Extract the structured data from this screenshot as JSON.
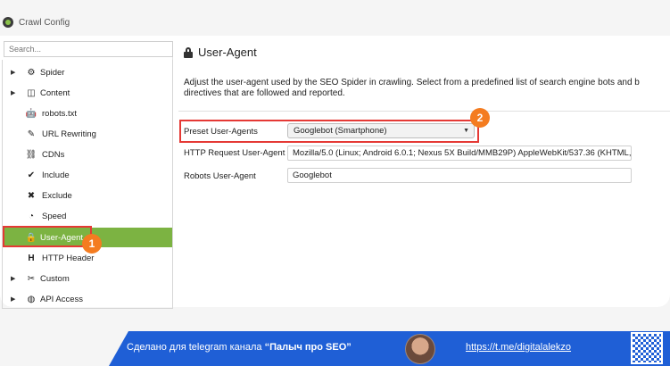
{
  "window": {
    "title": "Crawl Config"
  },
  "sidebar": {
    "search_placeholder": "Search...",
    "items": [
      {
        "label": "Spider",
        "icon": "gear-icon",
        "expandable": true
      },
      {
        "label": "Content",
        "icon": "columns-icon",
        "expandable": true
      },
      {
        "label": "robots.txt",
        "icon": "robot-icon",
        "expandable": false
      },
      {
        "label": "URL Rewriting",
        "icon": "rewrite-icon",
        "expandable": false
      },
      {
        "label": "CDNs",
        "icon": "network-icon",
        "expandable": false
      },
      {
        "label": "Include",
        "icon": "check-circle-icon",
        "expandable": false
      },
      {
        "label": "Exclude",
        "icon": "x-circle-icon",
        "expandable": false
      },
      {
        "label": "Speed",
        "icon": "speedometer-icon",
        "expandable": false
      },
      {
        "label": "User-Agent",
        "icon": "user-agent-icon",
        "expandable": false,
        "selected": true
      },
      {
        "label": "HTTP Header",
        "icon": "header-h-icon",
        "expandable": false
      },
      {
        "label": "Custom",
        "icon": "tools-icon",
        "expandable": true
      },
      {
        "label": "API Access",
        "icon": "globe-icon",
        "expandable": true
      }
    ]
  },
  "main": {
    "title": "User-Agent",
    "description_line1": "Adjust the user-agent used by the SEO Spider in crawling. Select from a predefined list of search engine bots and b",
    "description_line2": "directives that are followed and reported.",
    "preset_label": "Preset User-Agents",
    "preset_value": "Googlebot (Smartphone)",
    "http_label": "HTTP Request User-Agent",
    "http_value": "Mozilla/5.0 (Linux; Android 6.0.1; Nexus 5X Build/MMB29P) AppleWebKit/537.36 (KHTML, l",
    "robots_label": "Robots User-Agent",
    "robots_value": "Googlebot"
  },
  "annotations": {
    "badge1": "1",
    "badge2": "2"
  },
  "footer": {
    "made_text": "Сделано для telegram канала ",
    "channel": "“Палыч про SEO”",
    "link": "https://t.me/digitalalekzo"
  },
  "colors": {
    "accent_green": "#7cb342",
    "highlight_red": "#e53935",
    "badge_orange": "#f47c20",
    "banner_blue": "#1f5fd6"
  }
}
